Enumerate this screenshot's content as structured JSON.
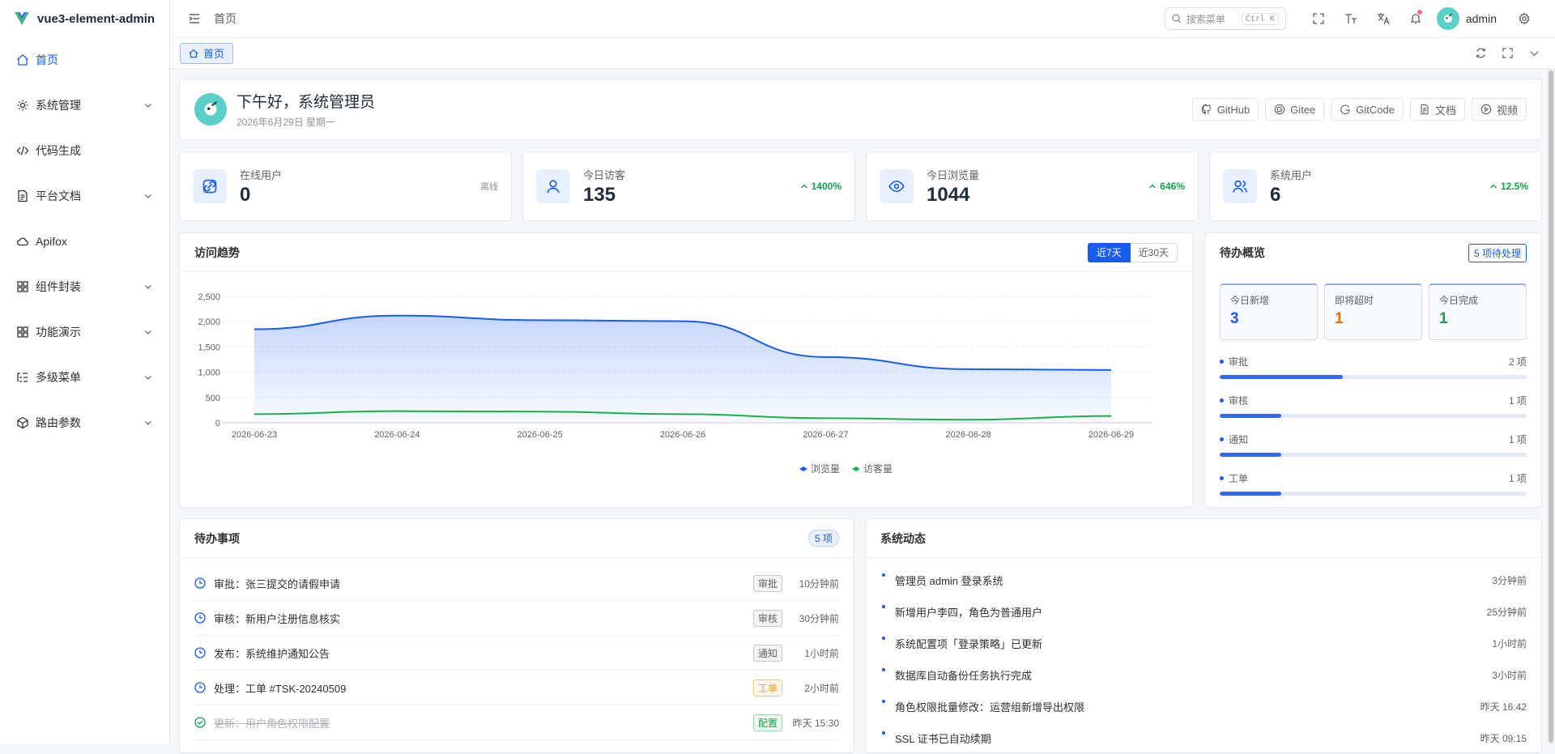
{
  "app": {
    "name": "vue3-element-admin"
  },
  "sidebar": {
    "items": [
      {
        "label": "首页",
        "icon": "home-icon",
        "active": true
      },
      {
        "label": "系统管理",
        "icon": "gear-icon"
      },
      {
        "label": "代码生成",
        "icon": "code-icon"
      },
      {
        "label": "平台文档",
        "icon": "document-icon"
      },
      {
        "label": "Apifox",
        "icon": "api-icon"
      },
      {
        "label": "组件封装",
        "icon": "grid-icon"
      },
      {
        "label": "功能演示",
        "icon": "grid-icon"
      },
      {
        "label": "多级菜单",
        "icon": "list-icon"
      },
      {
        "label": "路由参数",
        "icon": "cube-icon"
      }
    ]
  },
  "header": {
    "breadcrumb": "首页",
    "search_placeholder": "搜索菜单",
    "search_shortcut": "Ctrl K",
    "username": "admin"
  },
  "tags": {
    "active": "首页"
  },
  "welcome": {
    "greeting": "下午好，系统管理员",
    "date": "2026年6月29日 星期一",
    "links": [
      "GitHub",
      "Gitee",
      "GitCode",
      "文档",
      "视频"
    ]
  },
  "stats": [
    {
      "label": "在线用户",
      "value": "0",
      "trend": "离线",
      "icon": "link-icon"
    },
    {
      "label": "今日访客",
      "value": "135",
      "trend": "1400%",
      "icon": "user-icon"
    },
    {
      "label": "今日浏览量",
      "value": "1044",
      "trend": "646%",
      "icon": "eye-icon"
    },
    {
      "label": "系统用户",
      "value": "6",
      "trend": "12.5%",
      "icon": "users-icon"
    }
  ],
  "trend_card": {
    "title": "访问趋势",
    "range_7": "近7天",
    "range_30": "近30天"
  },
  "chart_data": {
    "type": "area",
    "categories": [
      "2026-06-23",
      "2026-06-24",
      "2026-06-25",
      "2026-06-26",
      "2026-06-27",
      "2026-06-28",
      "2026-06-29"
    ],
    "series": [
      {
        "name": "浏览量",
        "values": [
          1850,
          2120,
          2030,
          2010,
          1300,
          1060,
          1044
        ],
        "color": "#1a5cf0"
      },
      {
        "name": "访客量",
        "values": [
          170,
          230,
          220,
          170,
          90,
          60,
          135
        ],
        "color": "#16b34a"
      }
    ],
    "ylim": [
      0,
      2500
    ],
    "yticks": [
      "0",
      "500",
      "1,000",
      "1,500",
      "2,000",
      "2,500"
    ],
    "legend": "bottom",
    "grid": true
  },
  "overview": {
    "title": "待办概览",
    "badge": "5 项待处理",
    "boxes": [
      {
        "label": "今日新增",
        "value": "3",
        "color": "#1a5cf0"
      },
      {
        "label": "即将超时",
        "value": "1",
        "color": "#f56c0c"
      },
      {
        "label": "今日完成",
        "value": "1",
        "color": "#15a04a"
      }
    ],
    "progress": [
      {
        "label": "审批",
        "count": "2 项",
        "fraction": 0.4
      },
      {
        "label": "审核",
        "count": "1 项",
        "fraction": 0.2
      },
      {
        "label": "通知",
        "count": "1 项",
        "fraction": 0.2
      },
      {
        "label": "工单",
        "count": "1 项",
        "fraction": 0.2
      }
    ]
  },
  "todos": {
    "title": "待办事项",
    "count": "5 项",
    "items": [
      {
        "text": "审批：张三提交的请假申请",
        "tag": "审批",
        "tag_style": "",
        "time": "10分钟前",
        "done": false
      },
      {
        "text": "审核：新用户注册信息核实",
        "tag": "审核",
        "tag_style": "",
        "time": "30分钟前",
        "done": false
      },
      {
        "text": "发布：系统维护通知公告",
        "tag": "通知",
        "tag_style": "",
        "time": "1小时前",
        "done": false
      },
      {
        "text": "处理：工单 #TSK-20240509",
        "tag": "工单",
        "tag_style": "warn",
        "time": "2小时前",
        "done": false
      },
      {
        "text": "更新：用户角色权限配置",
        "tag": "配置",
        "tag_style": "ok",
        "time": "昨天 15:30",
        "done": true
      }
    ]
  },
  "system": {
    "title": "系统动态",
    "items": [
      {
        "text": "管理员 admin 登录系统",
        "time": "3分钟前"
      },
      {
        "text": "新增用户李四，角色为普通用户",
        "time": "25分钟前"
      },
      {
        "text": "系统配置项「登录策略」已更新",
        "time": "1小时前"
      },
      {
        "text": "数据库自动备份任务执行完成",
        "time": "3小时前"
      },
      {
        "text": "角色权限批量修改：运营组新增导出权限",
        "time": "昨天 16:42"
      },
      {
        "text": "SSL 证书已自动续期",
        "time": "昨天 09:15"
      }
    ]
  }
}
